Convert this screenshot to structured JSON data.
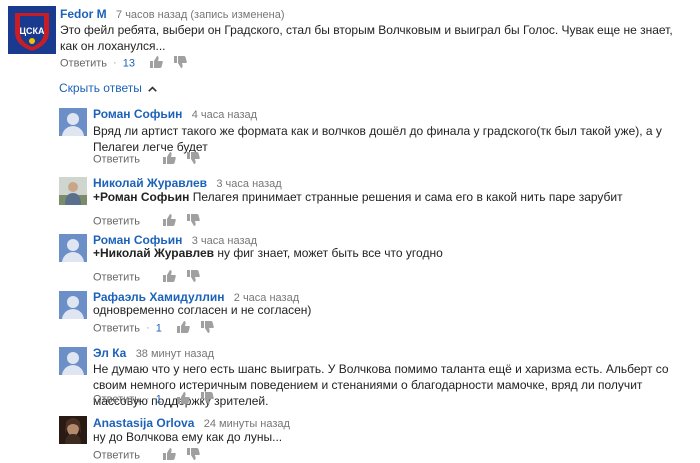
{
  "top_comment": {
    "author": "Fedor M",
    "time": "7 часов назад (запись изменена)",
    "text": "Это фейл ребята, выбери он Градского, стал бы вторым Волчковым и выиграл бы Голос. Чувак еще не знает, как он лоханулся...",
    "reply_label": "Ответить",
    "likes": "13"
  },
  "replies_toggle": {
    "label": "Скрыть ответы",
    "icon": "chevron-up-icon"
  },
  "replies": [
    {
      "author": "Роман Софьин",
      "time": "4 часа назад",
      "mention": "",
      "text": "Вряд ли артист такого же формата как и волчков дошёл до финала у градского(тк был такой уже), а у Пелагеи легче будет",
      "reply_label": "Ответить",
      "likes": ""
    },
    {
      "author": "Николай Журавлев",
      "time": "3 часа назад",
      "mention": "+Роман Софьин",
      "text": "Пелагея принимает странные решения и сама его в какой нить паре зарубит",
      "reply_label": "Ответить",
      "likes": ""
    },
    {
      "author": "Роман Софьин",
      "time": "3 часа назад",
      "mention": "+Николай Журавлев",
      "text": "ну фиг знает, может быть все что угодно",
      "reply_label": "Ответить",
      "likes": ""
    },
    {
      "author": "Рафаэль Хамидуллин",
      "time": "2 часа назад",
      "mention": "",
      "text": "одновременно согласен и не согласен)",
      "reply_label": "Ответить",
      "likes": "1"
    },
    {
      "author": "Эл Ка",
      "time": "38 минут назад",
      "mention": "",
      "text": "Не думаю что у него есть шанс выиграть. У Волчкова помимо таланта ещё и харизма есть. Альберт со своим немного истеричным поведением и стенаниями о благодарности мамочке, вряд ли получит массовую поддержку зрителей.",
      "reply_label": "Ответить",
      "likes": "1"
    },
    {
      "author": "Anastasija Orlova",
      "time": "24 минуты назад",
      "mention": "",
      "text": "ну до Волчкова ему как до луны...",
      "reply_label": "Ответить",
      "likes": ""
    }
  ],
  "colors": {
    "link": "#1c62b9",
    "meta": "#767676",
    "text": "#222222"
  }
}
